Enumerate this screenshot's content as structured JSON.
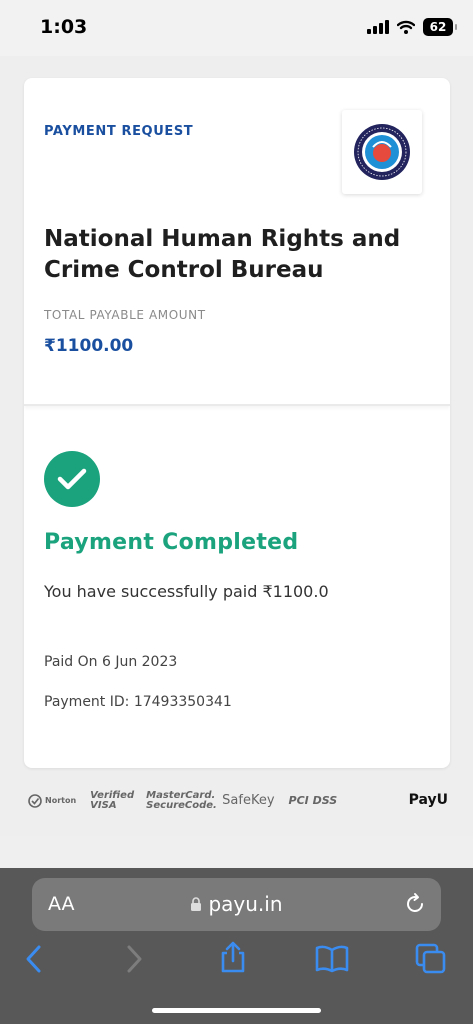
{
  "status": {
    "time": "1:03",
    "battery": "62"
  },
  "payment": {
    "request_label": "PAYMENT REQUEST",
    "merchant_name": "National Human Rights and Crime Control Bureau",
    "total_label": "TOTAL PAYABLE AMOUNT",
    "amount": "₹1100.00",
    "status_title": "Payment Completed",
    "success_message": "You have successfully paid ₹1100.0",
    "paid_on": "Paid On 6 Jun 2023",
    "payment_id": "Payment ID: 17493350341"
  },
  "footer": {
    "logos": [
      "Norton",
      "Verified VISA",
      "MasterCard. SecureCode.",
      "SafeKey",
      "PCI DSS"
    ],
    "payu": "PayU"
  },
  "browser": {
    "aa": "AA",
    "url": "payu.in"
  },
  "colors": {
    "accent_blue": "#1a4fa0",
    "success_green": "#1ba37e"
  }
}
